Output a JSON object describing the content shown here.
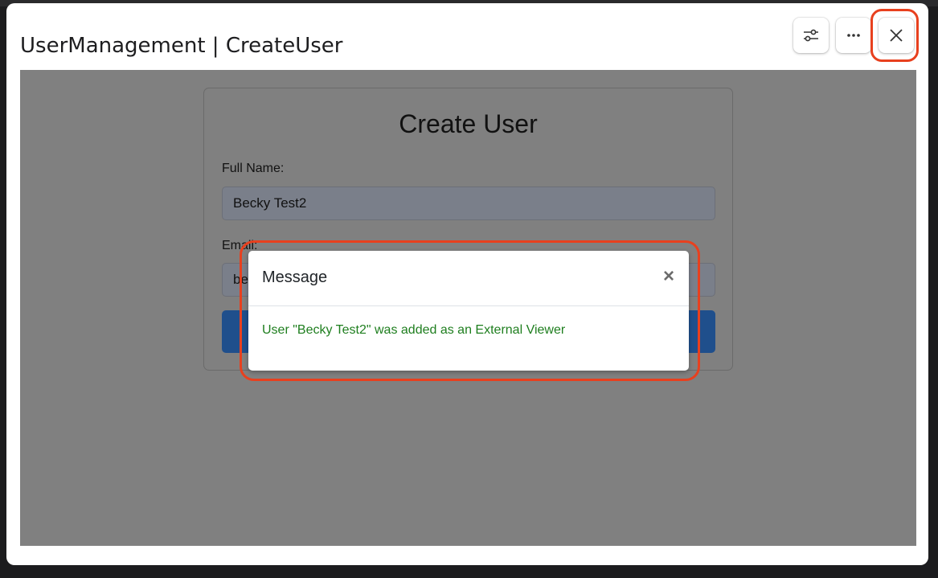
{
  "window": {
    "title": "UserManagement | CreateUser"
  },
  "toolbar": {
    "settings_icon": "sliders-icon",
    "more_icon": "ellipsis-icon",
    "close_icon": "close-icon"
  },
  "form": {
    "title": "Create User",
    "full_name_label": "Full Name:",
    "full_name_value": "Becky Test2",
    "email_label": "Email:",
    "email_value_visible": "be"
  },
  "modal": {
    "title": "Message",
    "close_glyph": "×",
    "message": "User \"Becky Test2\" was added as an External Viewer"
  },
  "colors": {
    "highlight": "#e8401e",
    "overlay": "#808080",
    "success_text": "#1e7e1e",
    "primary_button": "#1f4f8c"
  }
}
